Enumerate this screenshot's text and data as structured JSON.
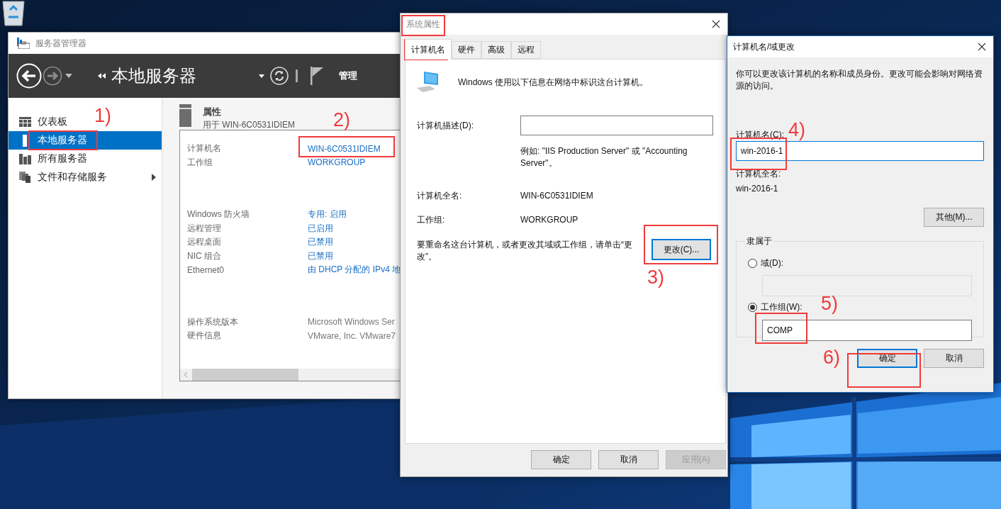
{
  "server_manager": {
    "title": "服务器管理器",
    "breadcrumb": "本地服务器",
    "menu": "管理",
    "sidebar": [
      {
        "label": "仪表板",
        "selected": false,
        "expandable": false
      },
      {
        "label": "本地服务器",
        "selected": true,
        "expandable": false
      },
      {
        "label": "所有服务器",
        "selected": false,
        "expandable": false
      },
      {
        "label": "文件和存储服务",
        "selected": false,
        "expandable": true
      }
    ],
    "properties": {
      "title": "属性",
      "subtitle": "用于 WIN-6C0531IDIEM",
      "groups": [
        [
          {
            "label": "计算机名",
            "value": "WIN-6C0531IDIEM",
            "link": true
          },
          {
            "label": "工作组",
            "value": "WORKGROUP",
            "link": true
          }
        ],
        [
          {
            "label": "Windows 防火墙",
            "value": "专用: 启用",
            "link": true
          },
          {
            "label": "远程管理",
            "value": "已启用",
            "link": true
          },
          {
            "label": "远程桌面",
            "value": "已禁用",
            "link": true
          },
          {
            "label": "NIC 组合",
            "value": "已禁用",
            "link": true
          },
          {
            "label": "Ethernet0",
            "value": "由 DHCP 分配的 IPv4 地",
            "link": true
          }
        ],
        [
          {
            "label": "操作系统版本",
            "value": "Microsoft Windows Ser",
            "link": false
          },
          {
            "label": "硬件信息",
            "value": "VMware, Inc. VMware7",
            "link": false
          }
        ]
      ]
    }
  },
  "system_properties": {
    "title": "系统属性",
    "tabs": [
      {
        "label": "计算机名",
        "selected": true
      },
      {
        "label": "硬件",
        "selected": false
      },
      {
        "label": "高级",
        "selected": false
      },
      {
        "label": "远程",
        "selected": false
      }
    ],
    "intro": "Windows 使用以下信息在网络中标识这台计算机。",
    "description_label": "计算机描述(D):",
    "example": "例如: \"IIS Production Server\" 或 \"Accounting Server\"。",
    "full_name_label": "计算机全名:",
    "full_name": "WIN-6C0531IDIEM",
    "workgroup_label": "工作组:",
    "workgroup": "WORKGROUP",
    "rename_text": "要重命名这台计算机，或者更改其域或工作组，请单击“更改”。",
    "change_button": {
      "label": "更改(C)...",
      "focused": true
    },
    "buttons": [
      {
        "label": "确定",
        "disabled": false
      },
      {
        "label": "取消",
        "disabled": false
      },
      {
        "label": "应用(A)",
        "disabled": true
      }
    ]
  },
  "name_dialog": {
    "title": "计算机名/域更改",
    "intro": "你可以更改该计算机的名称和成员身份。更改可能会影响对网络资源的访问。",
    "name_label": "计算机名(C):",
    "name_value": "win-2016-1",
    "full_name_label": "计算机全名:",
    "full_name": "win-2016-1",
    "more_button": "其他(M)...",
    "member_of": {
      "legend": "隶属于",
      "options": [
        {
          "label": "域(D):",
          "selected": false
        },
        {
          "label": "工作组(W):",
          "selected": true,
          "value": "COMP"
        }
      ]
    },
    "buttons": [
      {
        "label": "确定",
        "focused": true
      },
      {
        "label": "取消",
        "focused": false
      }
    ]
  },
  "annotations": [
    {
      "label": "1)"
    },
    {
      "label": "2)"
    },
    {
      "label": "3)"
    },
    {
      "label": "4)"
    },
    {
      "label": "5)"
    },
    {
      "label": "6)"
    }
  ]
}
